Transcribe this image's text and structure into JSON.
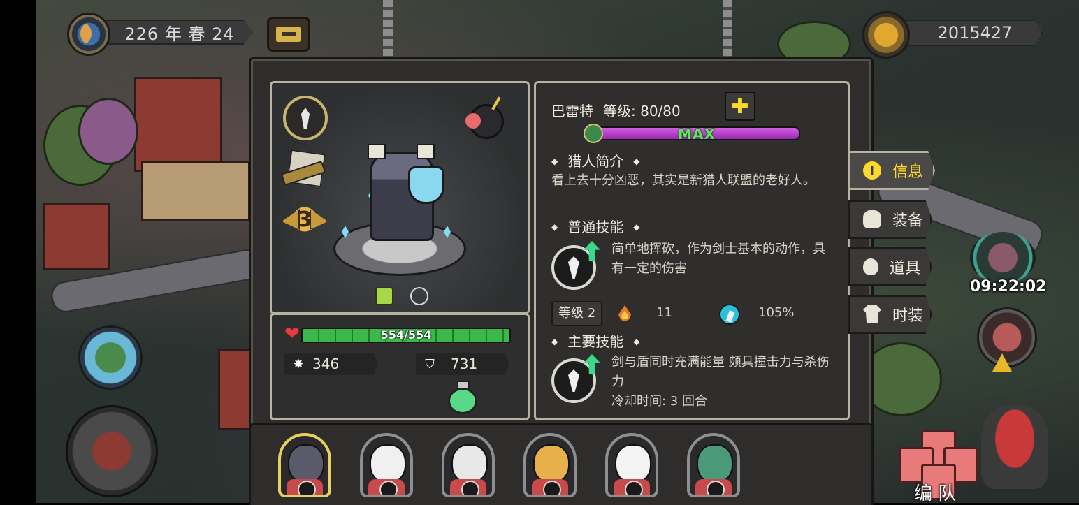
{
  "top": {
    "date_text": "226 年 春 24",
    "gold_amount": "2015427"
  },
  "hero": {
    "rank": "3",
    "hp": {
      "text": "554/554",
      "fraction": 1.0
    },
    "attack": "346",
    "defense": "731"
  },
  "info": {
    "name": "巴雷特",
    "level_text": "等级: 80/80",
    "xp": {
      "label": "MAX",
      "fraction": 1.0
    },
    "bio_title": "猎人简介",
    "bio": "看上去十分凶恶，其实是新猎人联盟的老好人。",
    "normal_skill": {
      "title": "普通技能",
      "desc": "简单地挥砍，作为剑士基本的动作，具有一定的伤害",
      "level": "等级 2",
      "power": "11",
      "crit": "105%"
    },
    "main_skill": {
      "title": "主要技能",
      "desc": "剑与盾同时充满能量 颇具撞击力与杀伤力",
      "cooldown": "冷却时间: 3 回合"
    }
  },
  "tabs": [
    {
      "label": "信息",
      "icon": "info-icon",
      "active": true
    },
    {
      "label": "装备",
      "icon": "helmet-icon",
      "active": false
    },
    {
      "label": "道具",
      "icon": "bag-icon",
      "active": false
    },
    {
      "label": "时装",
      "icon": "shirt-icon",
      "active": false
    }
  ],
  "timer": "09:22:02",
  "team_label": "编 队",
  "roster": [
    {
      "name": "boar-hunter",
      "face": "#5a5a6a",
      "selected": true
    },
    {
      "name": "eagle",
      "face": "#f0f0f0",
      "selected": false
    },
    {
      "name": "polar-bear",
      "face": "#e8e8e8",
      "selected": false
    },
    {
      "name": "leopard",
      "face": "#e8b04a",
      "selected": false
    },
    {
      "name": "white-hair",
      "face": "#f4f4f4",
      "selected": false
    },
    {
      "name": "crocodile",
      "face": "#4a9a7a",
      "selected": false
    }
  ],
  "colors": {
    "accent_yellow": "#ffd92a",
    "hp_green": "#3ab84a",
    "xp_purple": "#b040c8",
    "max_green": "#5ee85a"
  }
}
